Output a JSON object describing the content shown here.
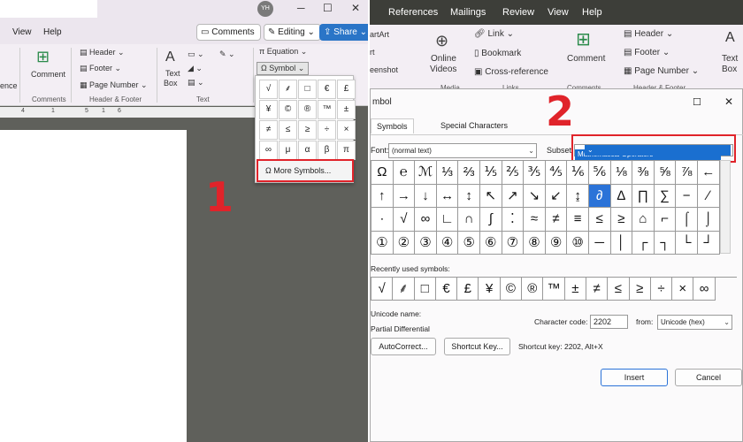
{
  "left": {
    "avatar": "YH",
    "menu": {
      "view": "View",
      "help": "Help"
    },
    "pills": {
      "comments": "Comments",
      "editing": "Editing",
      "share": "Share"
    },
    "ribbon": {
      "comment": "Comment",
      "ence": "ence",
      "header": "Header",
      "footer": "Footer",
      "page_number": "Page Number",
      "text_box": [
        "Text",
        "Box"
      ],
      "equation": "Equation",
      "symbol": "Symbol",
      "groups": {
        "comments": "Comments",
        "header_footer": "Header & Footer",
        "text": "Text"
      }
    },
    "ruler": [
      "4",
      "1",
      "5",
      "1",
      "6"
    ],
    "symbol_grid": [
      "√",
      "⸙",
      "□",
      "€",
      "£",
      "¥",
      "©",
      "®",
      "™",
      "±",
      "≠",
      "≤",
      "≥",
      "÷",
      "×",
      "∞",
      "μ",
      "α",
      "β",
      "π"
    ],
    "more_symbols": "More Symbols...",
    "step": "1"
  },
  "right": {
    "menu": [
      "References",
      "Mailings",
      "Review",
      "View",
      "Help"
    ],
    "ribbon": {
      "smartart": "artArt",
      "chart": "rt",
      "screenshot": "eenshot",
      "online_videos": [
        "Online",
        "Videos"
      ],
      "link": "Link",
      "bookmark": "Bookmark",
      "cross_reference": "Cross-reference",
      "comment": "Comment",
      "header": "Header",
      "footer": "Footer",
      "page_number": "Page Number",
      "text_box": [
        "Text",
        "Box"
      ],
      "groups": {
        "media": "Media",
        "links": "Links",
        "comments": "Comments",
        "header_footer": "Header & Footer"
      }
    },
    "step": "2"
  },
  "dialog": {
    "title": "mbol",
    "tabs": {
      "symbols": "Symbols",
      "special": "Special Characters"
    },
    "font_label": "Font:",
    "font_value": "(normal text)",
    "subset_label": "Subset",
    "subset_value": "Mathematical Operators",
    "symbol_rows": [
      [
        "Ω",
        "℮",
        "ℳ",
        "⅓",
        "⅔",
        "⅕",
        "⅖",
        "⅗",
        "⅘",
        "⅙",
        "⅚",
        "⅛",
        "⅜",
        "⅝",
        "⅞",
        "←"
      ],
      [
        "↑",
        "→",
        "↓",
        "↔",
        "↕",
        "↖",
        "↗",
        "↘",
        "↙",
        "↨",
        "∂",
        "∆",
        "∏",
        "∑",
        "−",
        "∕"
      ],
      [
        "∙",
        "√",
        "∞",
        "∟",
        "∩",
        "∫",
        "⁚",
        "≈",
        "≠",
        "≡",
        "≤",
        "≥",
        "⌂",
        "⌐",
        "⌠",
        "⌡"
      ],
      [
        "①",
        "②",
        "③",
        "④",
        "⑤",
        "⑥",
        "⑦",
        "⑧",
        "⑨",
        "⑩",
        "─",
        "│",
        "┌",
        "┐",
        "└",
        "┘"
      ]
    ],
    "recent_label": "Recently used symbols:",
    "recent_symbols": [
      "√",
      "⸙",
      "□",
      "€",
      "£",
      "¥",
      "©",
      "®",
      "™",
      "±",
      "≠",
      "≤",
      "≥",
      "÷",
      "×",
      "∞"
    ],
    "unicode_name_label": "Unicode name:",
    "unicode_name_value": "Partial Differential",
    "char_code_label": "Character code:",
    "char_code_value": "2202",
    "from_label": "from:",
    "from_value": "Unicode (hex)",
    "autocorrect": "AutoCorrect...",
    "shortcut_key_btn": "Shortcut Key...",
    "shortcut_key_text": "Shortcut key: 2202, Alt+X",
    "insert": "Insert",
    "cancel": "Cancel"
  }
}
